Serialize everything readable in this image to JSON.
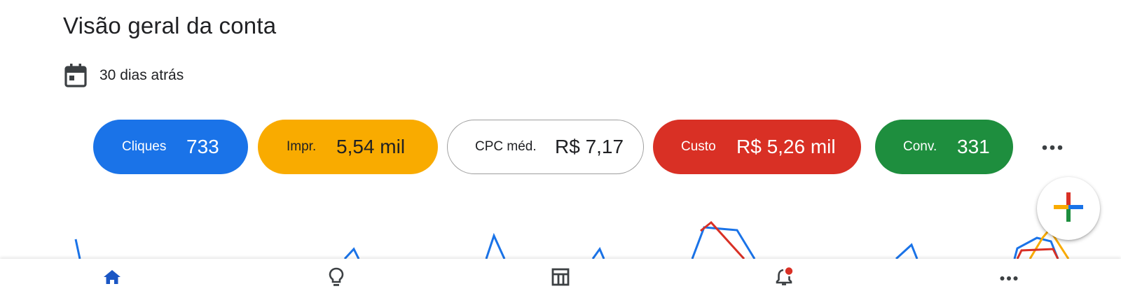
{
  "header": {
    "title": "Visão geral da conta"
  },
  "date_range": {
    "label": "30 dias atrás",
    "icon": "calendar-icon"
  },
  "metrics": [
    {
      "label": "Cliques",
      "value": "733",
      "color": "#1a73e8"
    },
    {
      "label": "Impr.",
      "value": "5,54 mil",
      "color": "#f9ab00"
    },
    {
      "label": "CPC méd.",
      "value": "R$ 7,17",
      "color": "#ffffff"
    },
    {
      "label": "Custo",
      "value": "R$ 5,26 mil",
      "color": "#d93025"
    },
    {
      "label": "Conv.",
      "value": "331",
      "color": "#1e8e3e"
    }
  ],
  "more_metrics_icon": "more-horizontal-icon",
  "fab_icon": "plus-icon",
  "bottom_nav": [
    {
      "name": "home",
      "icon": "home-icon",
      "active": true
    },
    {
      "name": "recommendations",
      "icon": "lightbulb-icon",
      "active": false
    },
    {
      "name": "campaigns",
      "icon": "table-icon",
      "active": false
    },
    {
      "name": "notifications",
      "icon": "notification-bell-icon",
      "active": false,
      "badge": true
    },
    {
      "name": "more",
      "icon": "more-horizontal-icon",
      "active": false
    }
  ],
  "colors": {
    "blue": "#1a73e8",
    "yellow": "#f9ab00",
    "red": "#d93025",
    "green": "#1e8e3e",
    "nav_active": "#1a56c4"
  }
}
